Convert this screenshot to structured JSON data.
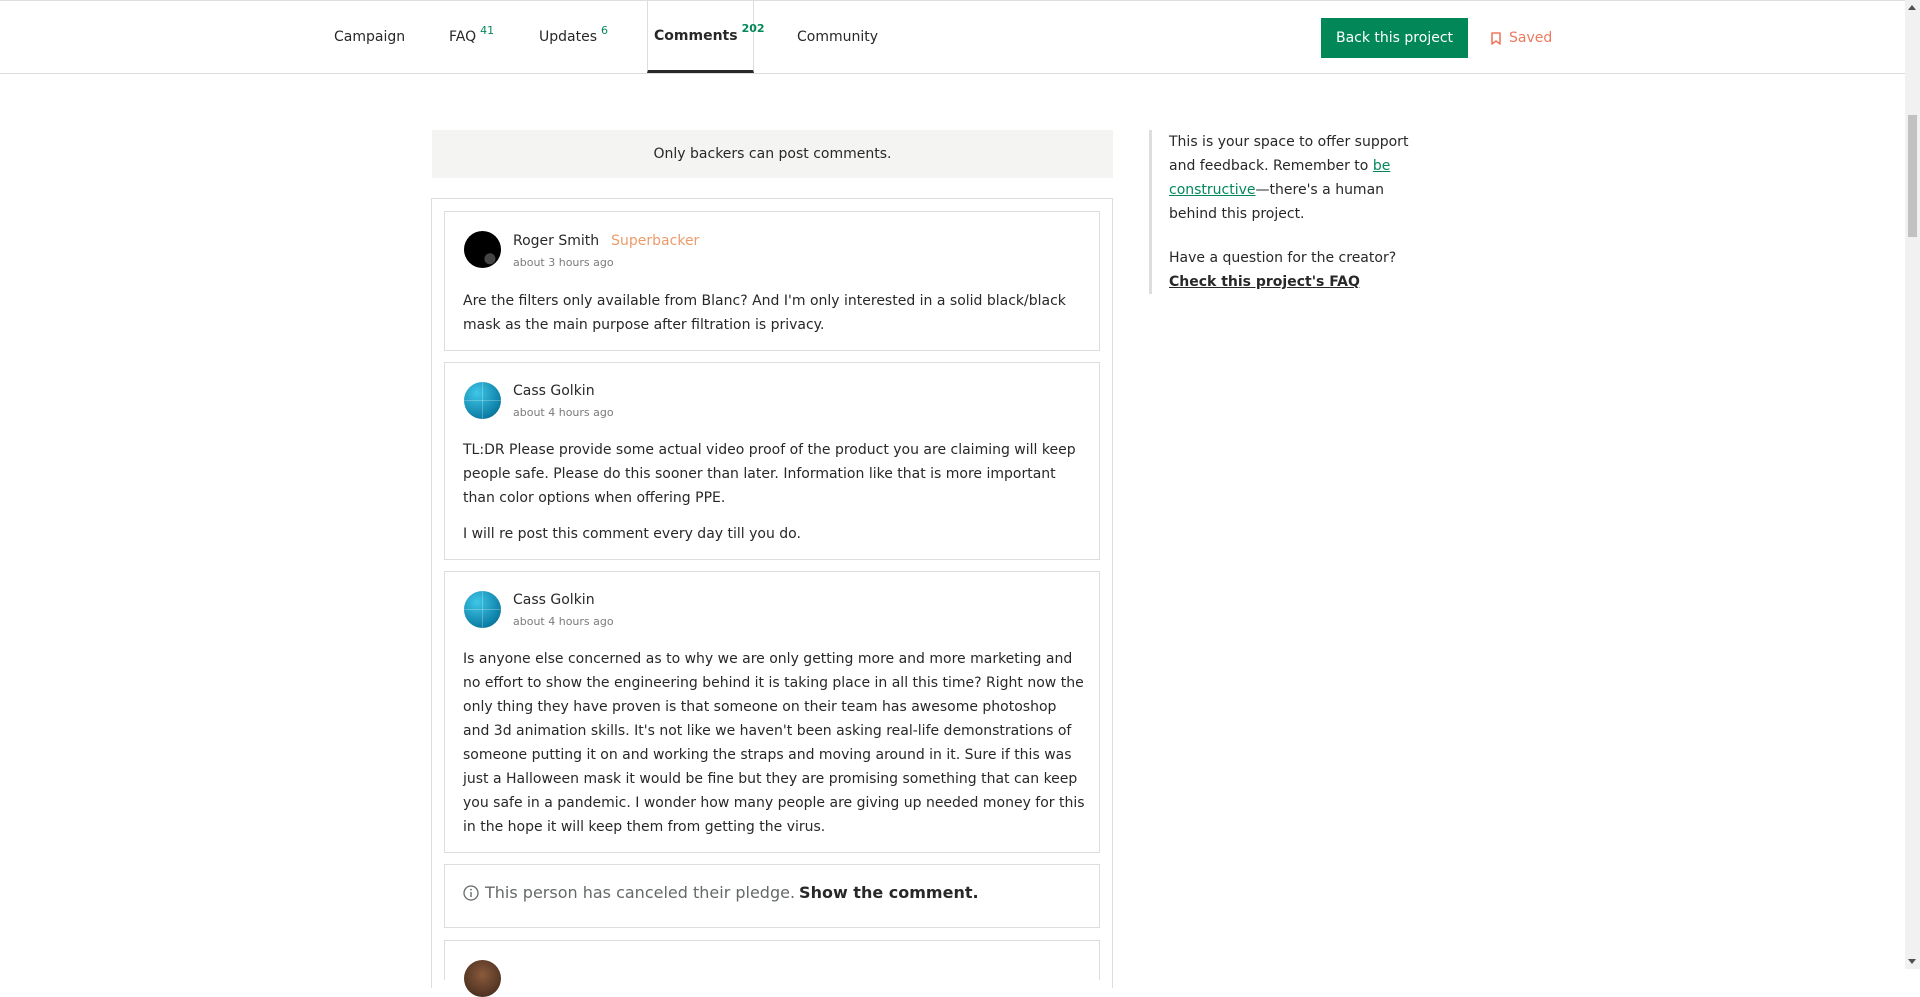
{
  "nav": {
    "tabs": [
      {
        "label": "Campaign",
        "count": ""
      },
      {
        "label": "FAQ",
        "count": "41"
      },
      {
        "label": "Updates",
        "count": "6"
      },
      {
        "label": "Comments",
        "count": "202"
      },
      {
        "label": "Community",
        "count": ""
      }
    ],
    "back_label": "Back this project",
    "saved_label": "Saved",
    "accent": "#028858",
    "saved_color": "#ec7a5f"
  },
  "notice": "Only backers can post comments.",
  "comments": [
    {
      "author": "Roger Smith",
      "badge": "Superbacker",
      "time": "about 3 hours ago",
      "paragraphs": [
        "Are the filters only available from Blanc? And I'm only interested in a solid black/black mask as the main purpose after filtration is privacy."
      ]
    },
    {
      "author": "Cass Golkin",
      "badge": "",
      "time": "about 4 hours ago",
      "paragraphs": [
        "TL:DR Please provide some actual video proof of the product you are claiming will keep people safe. Please do this sooner than later. Information like that is more important than color options when offering PPE.",
        "I will re post this comment every day till you do."
      ]
    },
    {
      "author": "Cass Golkin",
      "badge": "",
      "time": "about 4 hours ago",
      "paragraphs": [
        "Is anyone else concerned as to why we are only getting more and more marketing and no effort to show the engineering behind it is taking place in all this time? Right now the only thing they have proven is that someone on their team has awesome photoshop and 3d animation skills. It's not like we haven't been asking real-life demonstrations of someone putting it on and working the straps and moving around in it. Sure if this was just a Halloween mask it would be fine but they are promising something that can keep you safe in a pandemic. I wonder how many people are giving up needed money for this in the hope it will keep them from getting the virus."
      ]
    }
  ],
  "canceled": {
    "text": "This person has canceled their pledge.",
    "link": "Show the comment."
  },
  "sidebar": {
    "text_before": "This is your space to offer support and feedback. Remember to ",
    "link": "be constructive",
    "text_after": "—there's a human behind this project.",
    "question": "Have a question for the creator?",
    "faq_link": "Check this project's FAQ"
  }
}
